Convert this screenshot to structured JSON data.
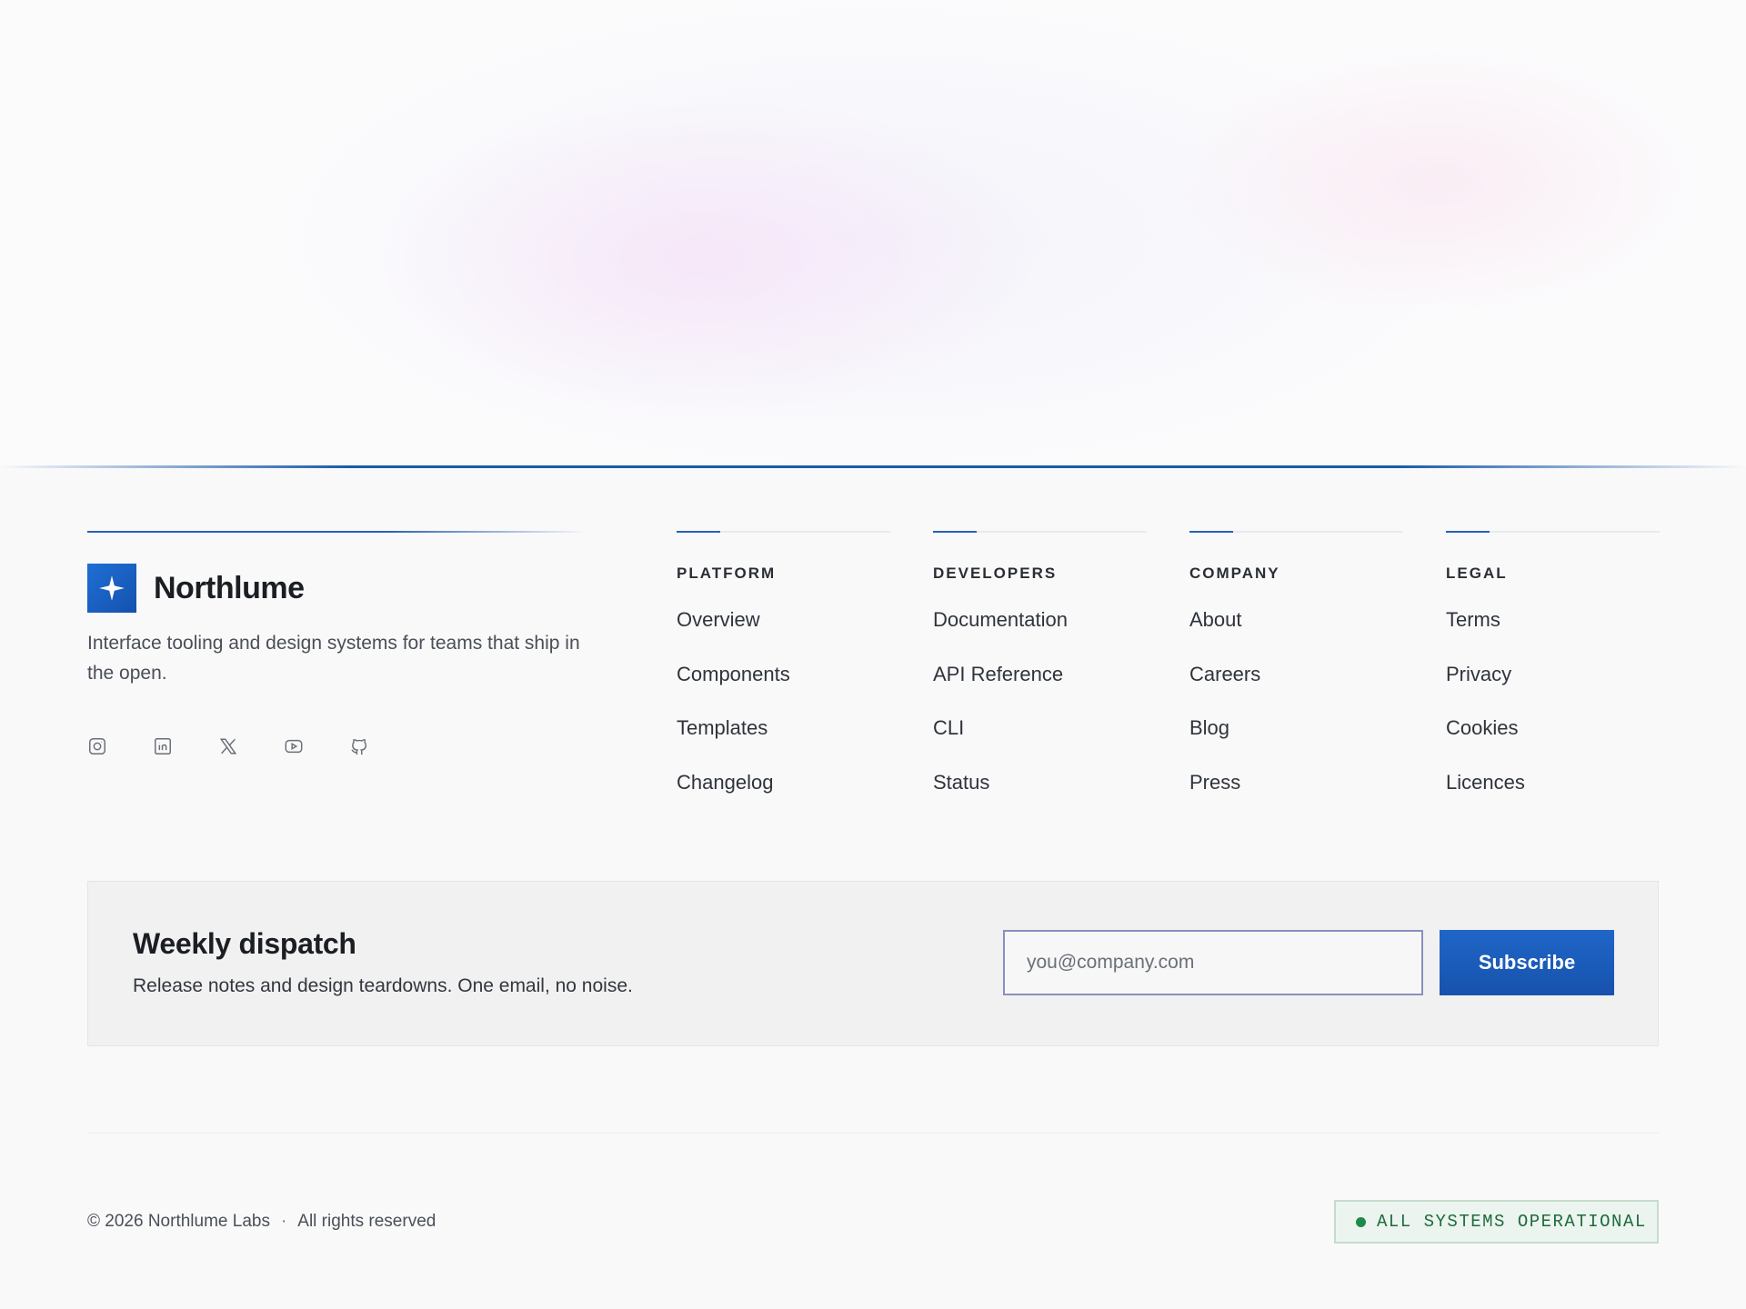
{
  "brand": {
    "name": "Northlume",
    "tagline": "Interface tooling and design systems for teams that ship in the open."
  },
  "socials": [
    {
      "icon": "instagram-icon"
    },
    {
      "icon": "linkedin-icon"
    },
    {
      "icon": "x-icon"
    },
    {
      "icon": "youtube-icon"
    },
    {
      "icon": "github-icon"
    }
  ],
  "columns": [
    {
      "title": "PLATFORM",
      "links": [
        "Overview",
        "Components",
        "Templates",
        "Changelog"
      ]
    },
    {
      "title": "DEVELOPERS",
      "links": [
        "Documentation",
        "API Reference",
        "CLI",
        "Status"
      ]
    },
    {
      "title": "COMPANY",
      "links": [
        "About",
        "Careers",
        "Blog",
        "Press"
      ]
    },
    {
      "title": "LEGAL",
      "links": [
        "Terms",
        "Privacy",
        "Cookies",
        "Licences"
      ]
    }
  ],
  "newsletter": {
    "title": "Weekly dispatch",
    "description": "Release notes and design teardowns. One email, no noise.",
    "email_placeholder": "you@company.com",
    "subscribe_label": "Subscribe"
  },
  "bottom": {
    "copyright": "© 2026 Northlume Labs",
    "separator": "·",
    "rights": "All rights reserved",
    "status_label": "ALL SYSTEMS OPERATIONAL"
  },
  "colors": {
    "accent": "#1a5aa8",
    "button": "#1752ad",
    "status_green": "#1e6b3c"
  }
}
